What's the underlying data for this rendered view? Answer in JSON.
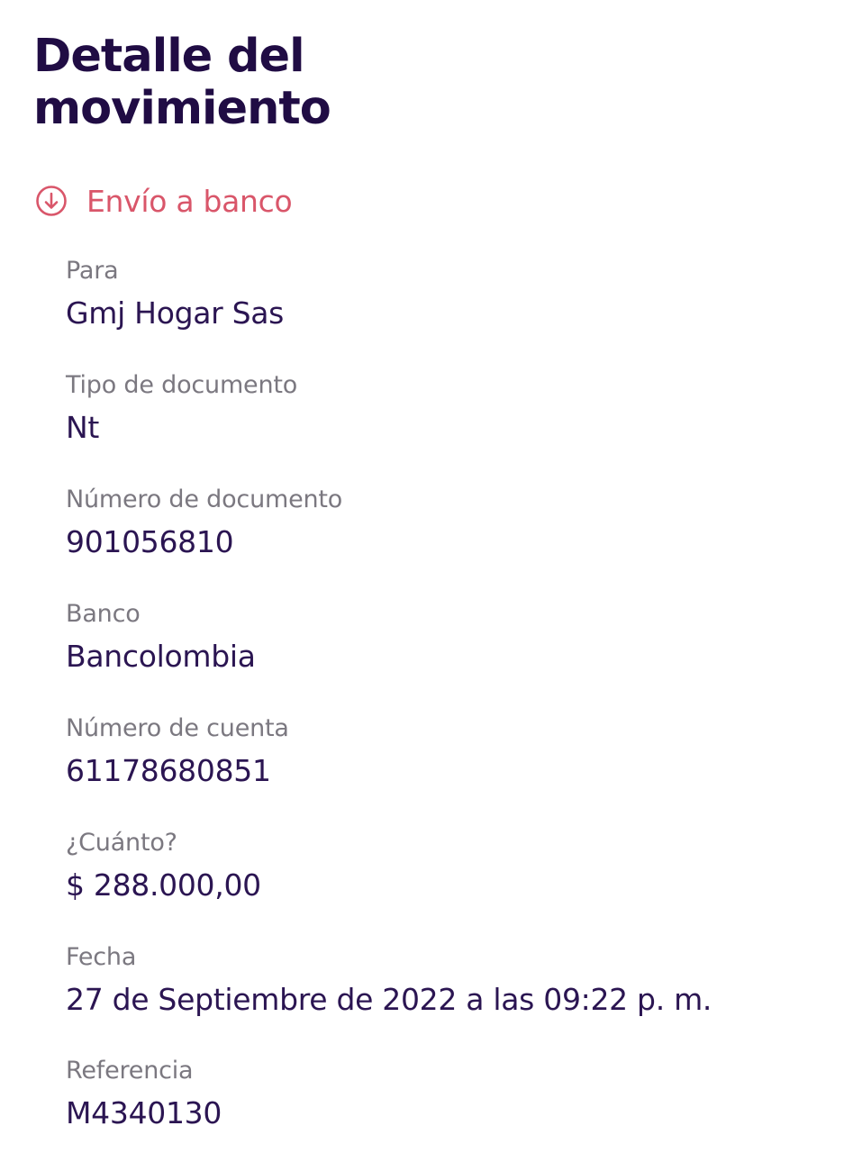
{
  "header": {
    "title_line1": "Detalle del",
    "title_line2": "movimiento"
  },
  "movement": {
    "icon": "arrow-down-circle-icon",
    "type_label": "Envío a banco",
    "accent_color": "#d9566a"
  },
  "fields": [
    {
      "label": "Para",
      "value": "Gmj Hogar Sas"
    },
    {
      "label": "Tipo de documento",
      "value": "Nt"
    },
    {
      "label": "Número de documento",
      "value": "901056810"
    },
    {
      "label": "Banco",
      "value": "Bancolombia"
    },
    {
      "label": "Número de cuenta",
      "value": "61178680851"
    },
    {
      "label": "¿Cuánto?",
      "value": "$ 288.000,00"
    },
    {
      "label": "Fecha",
      "value": "27 de Septiembre de 2022 a las 09:22 p. m."
    },
    {
      "label": "Referencia",
      "value": "M4340130"
    }
  ],
  "colors": {
    "title": "#200c44",
    "value_text": "#2b1552",
    "label_text": "#7b7880",
    "background": "#ffffff"
  }
}
